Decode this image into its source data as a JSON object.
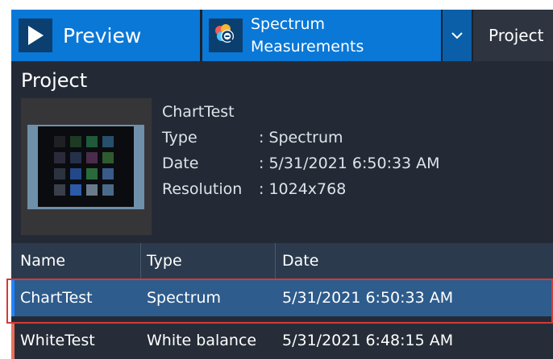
{
  "toolbar": {
    "preview_label": "Preview",
    "spectrum_line1": "Spectrum",
    "spectrum_line2": "Measurements",
    "project_tab": "Project",
    "icons": {
      "preview": "play-icon",
      "spectrum": "measurement-icon",
      "dropdown": "chevron-down-icon"
    }
  },
  "project": {
    "title": "Project",
    "name": "ChartTest",
    "fields": [
      {
        "key": "Type",
        "value": ": Spectrum"
      },
      {
        "key": "Date",
        "value": ": 5/31/2021 6:50:33 AM"
      },
      {
        "key": "Resolution",
        "value": ": 1024x768"
      }
    ]
  },
  "table": {
    "columns": [
      "Name",
      "Type",
      "Date"
    ],
    "rows": [
      {
        "name": "ChartTest",
        "type": "Spectrum",
        "date": "5/31/2021 6:50:33 AM",
        "selected": true
      },
      {
        "name": "WhiteTest",
        "type": "White balance",
        "date": "5/31/2021 6:48:15 AM",
        "selected": false
      }
    ]
  },
  "colors": {
    "accent_blue": "#0a78d7",
    "dark_bg": "#232a35",
    "selected_row": "#2e5c8c",
    "row_accent_selected": "#1e86ff",
    "row_accent_other": "#e8705c",
    "highlight_outline": "#d23a3a"
  }
}
